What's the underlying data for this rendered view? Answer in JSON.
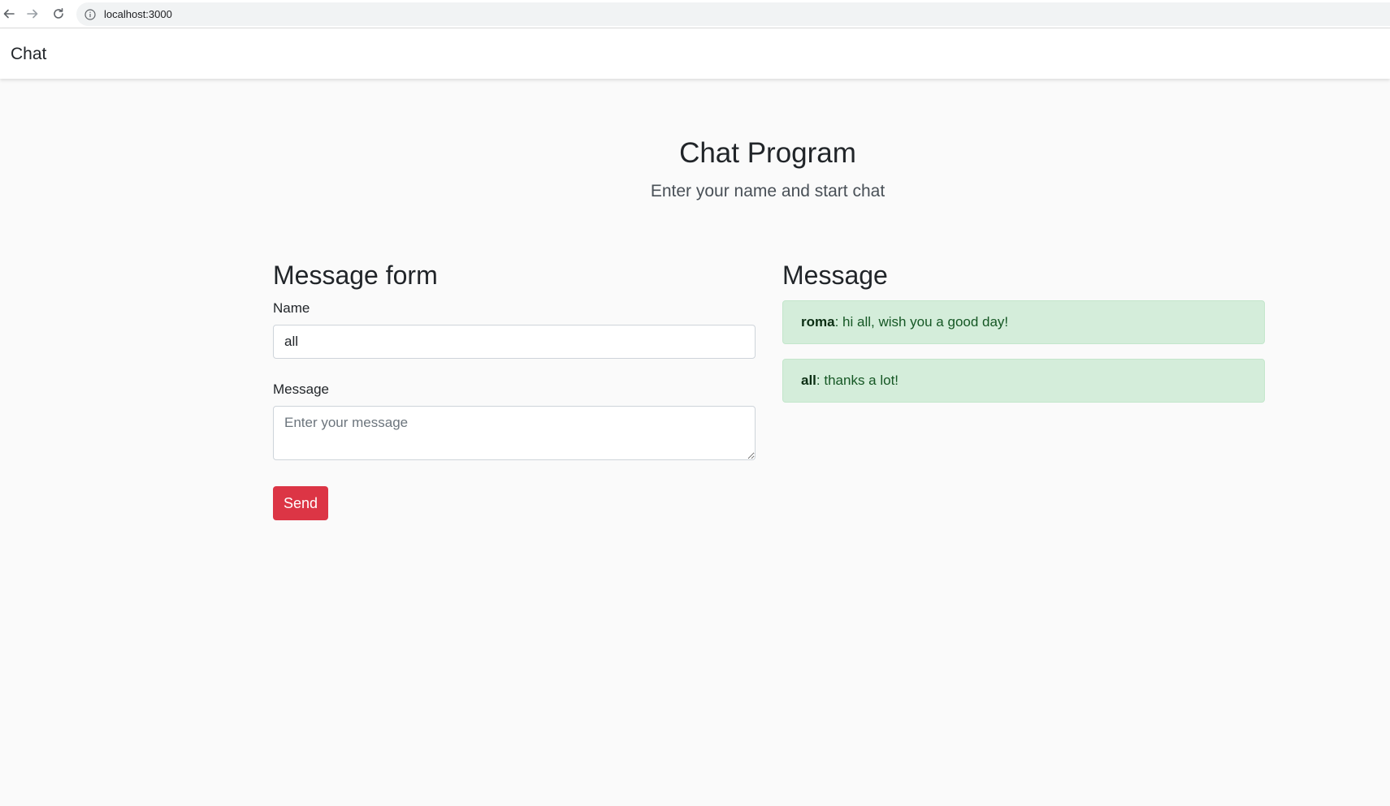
{
  "browser": {
    "url": "localhost:3000",
    "icons": [
      "back-arrow-icon",
      "forward-arrow-icon",
      "reload-icon",
      "info-icon"
    ]
  },
  "navbar": {
    "brand": "Chat"
  },
  "hero": {
    "title": "Chat Program",
    "subtitle": "Enter your name and start chat"
  },
  "form": {
    "title": "Message form",
    "name_label": "Name",
    "name_value": "all",
    "message_label": "Message",
    "message_placeholder": "Enter your message",
    "send_label": "Send"
  },
  "messages": {
    "title": "Message",
    "items": [
      {
        "author": "roma",
        "separator": ":",
        "text": " hi all, wish you a good day!"
      },
      {
        "author": "all",
        "separator": ":",
        "text": " thanks a lot!"
      }
    ]
  },
  "colors": {
    "send_button": "#dc3545",
    "message_bg": "#d4edda",
    "message_text": "#155724",
    "page_bg": "#fafafa"
  }
}
